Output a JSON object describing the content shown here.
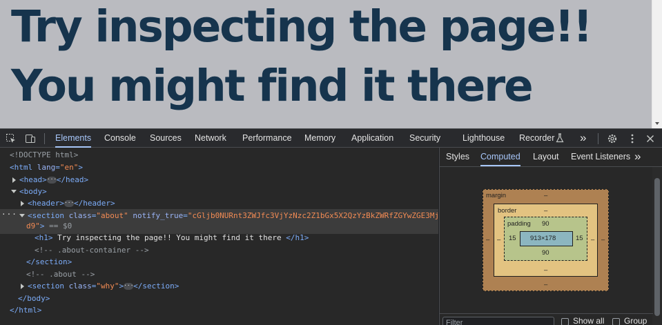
{
  "page": {
    "heading": "Try inspecting the page!! You might find it there"
  },
  "toolbar": {
    "tabs": [
      "Elements",
      "Console",
      "Sources",
      "Network",
      "Performance",
      "Memory",
      "Application",
      "Security",
      "Lighthouse",
      "Recorder"
    ],
    "active_tab": "Elements",
    "more_label": "»"
  },
  "dom": {
    "doctype": "<!DOCTYPE html>",
    "html_open_tag": "<html",
    "html_lang_attr": "lang",
    "html_lang_val": "\"en\"",
    "head_open": "<head>",
    "head_close": "</head>",
    "body_open": "<body>",
    "header_open": "<header>",
    "header_close": "</header>",
    "section_open": "<section",
    "class_attr": "class",
    "about_val": "\"about\"",
    "notify_attr": "notify_true",
    "notify_val_1": "\"cGljb0NURnt3ZWJfc3VjYzNzc2Z1bGx5X2QzYzBkZWRfZGYwZGE3Mj",
    "notify_val_2": "d9\"",
    "selected_suffix": "== $0",
    "h1_open": "<h1>",
    "h1_text": " Try inspecting the page!! You might find it there ",
    "h1_close": "</h1>",
    "comment_about_container": "<!-- .about-container -->",
    "section_close": "</section>",
    "comment_about": "<!-- .about -->",
    "why_val": "\"why\"",
    "body_close": "</body>",
    "html_close": "</html>",
    "eq": "=",
    "gt": ">"
  },
  "side_panel": {
    "tabs": [
      "Styles",
      "Computed",
      "Layout",
      "Event Listeners"
    ],
    "active_tab": "Computed",
    "more_label": "»",
    "box_model": {
      "margin_label": "margin",
      "margin_top": "–",
      "margin_bottom": "–",
      "margin_left": "–",
      "margin_right": "–",
      "border_label": "border",
      "border_top": "–",
      "border_bottom": "–",
      "border_left": "–",
      "border_right": "–",
      "padding_label": "padding",
      "padding_top": "90",
      "padding_bottom": "90",
      "padding_left": "15",
      "padding_right": "15",
      "content_size": "913×178",
      "content_bottom": "–"
    },
    "filter_placeholder": "Filter",
    "show_all_label": "Show all",
    "group_label": "Group"
  }
}
